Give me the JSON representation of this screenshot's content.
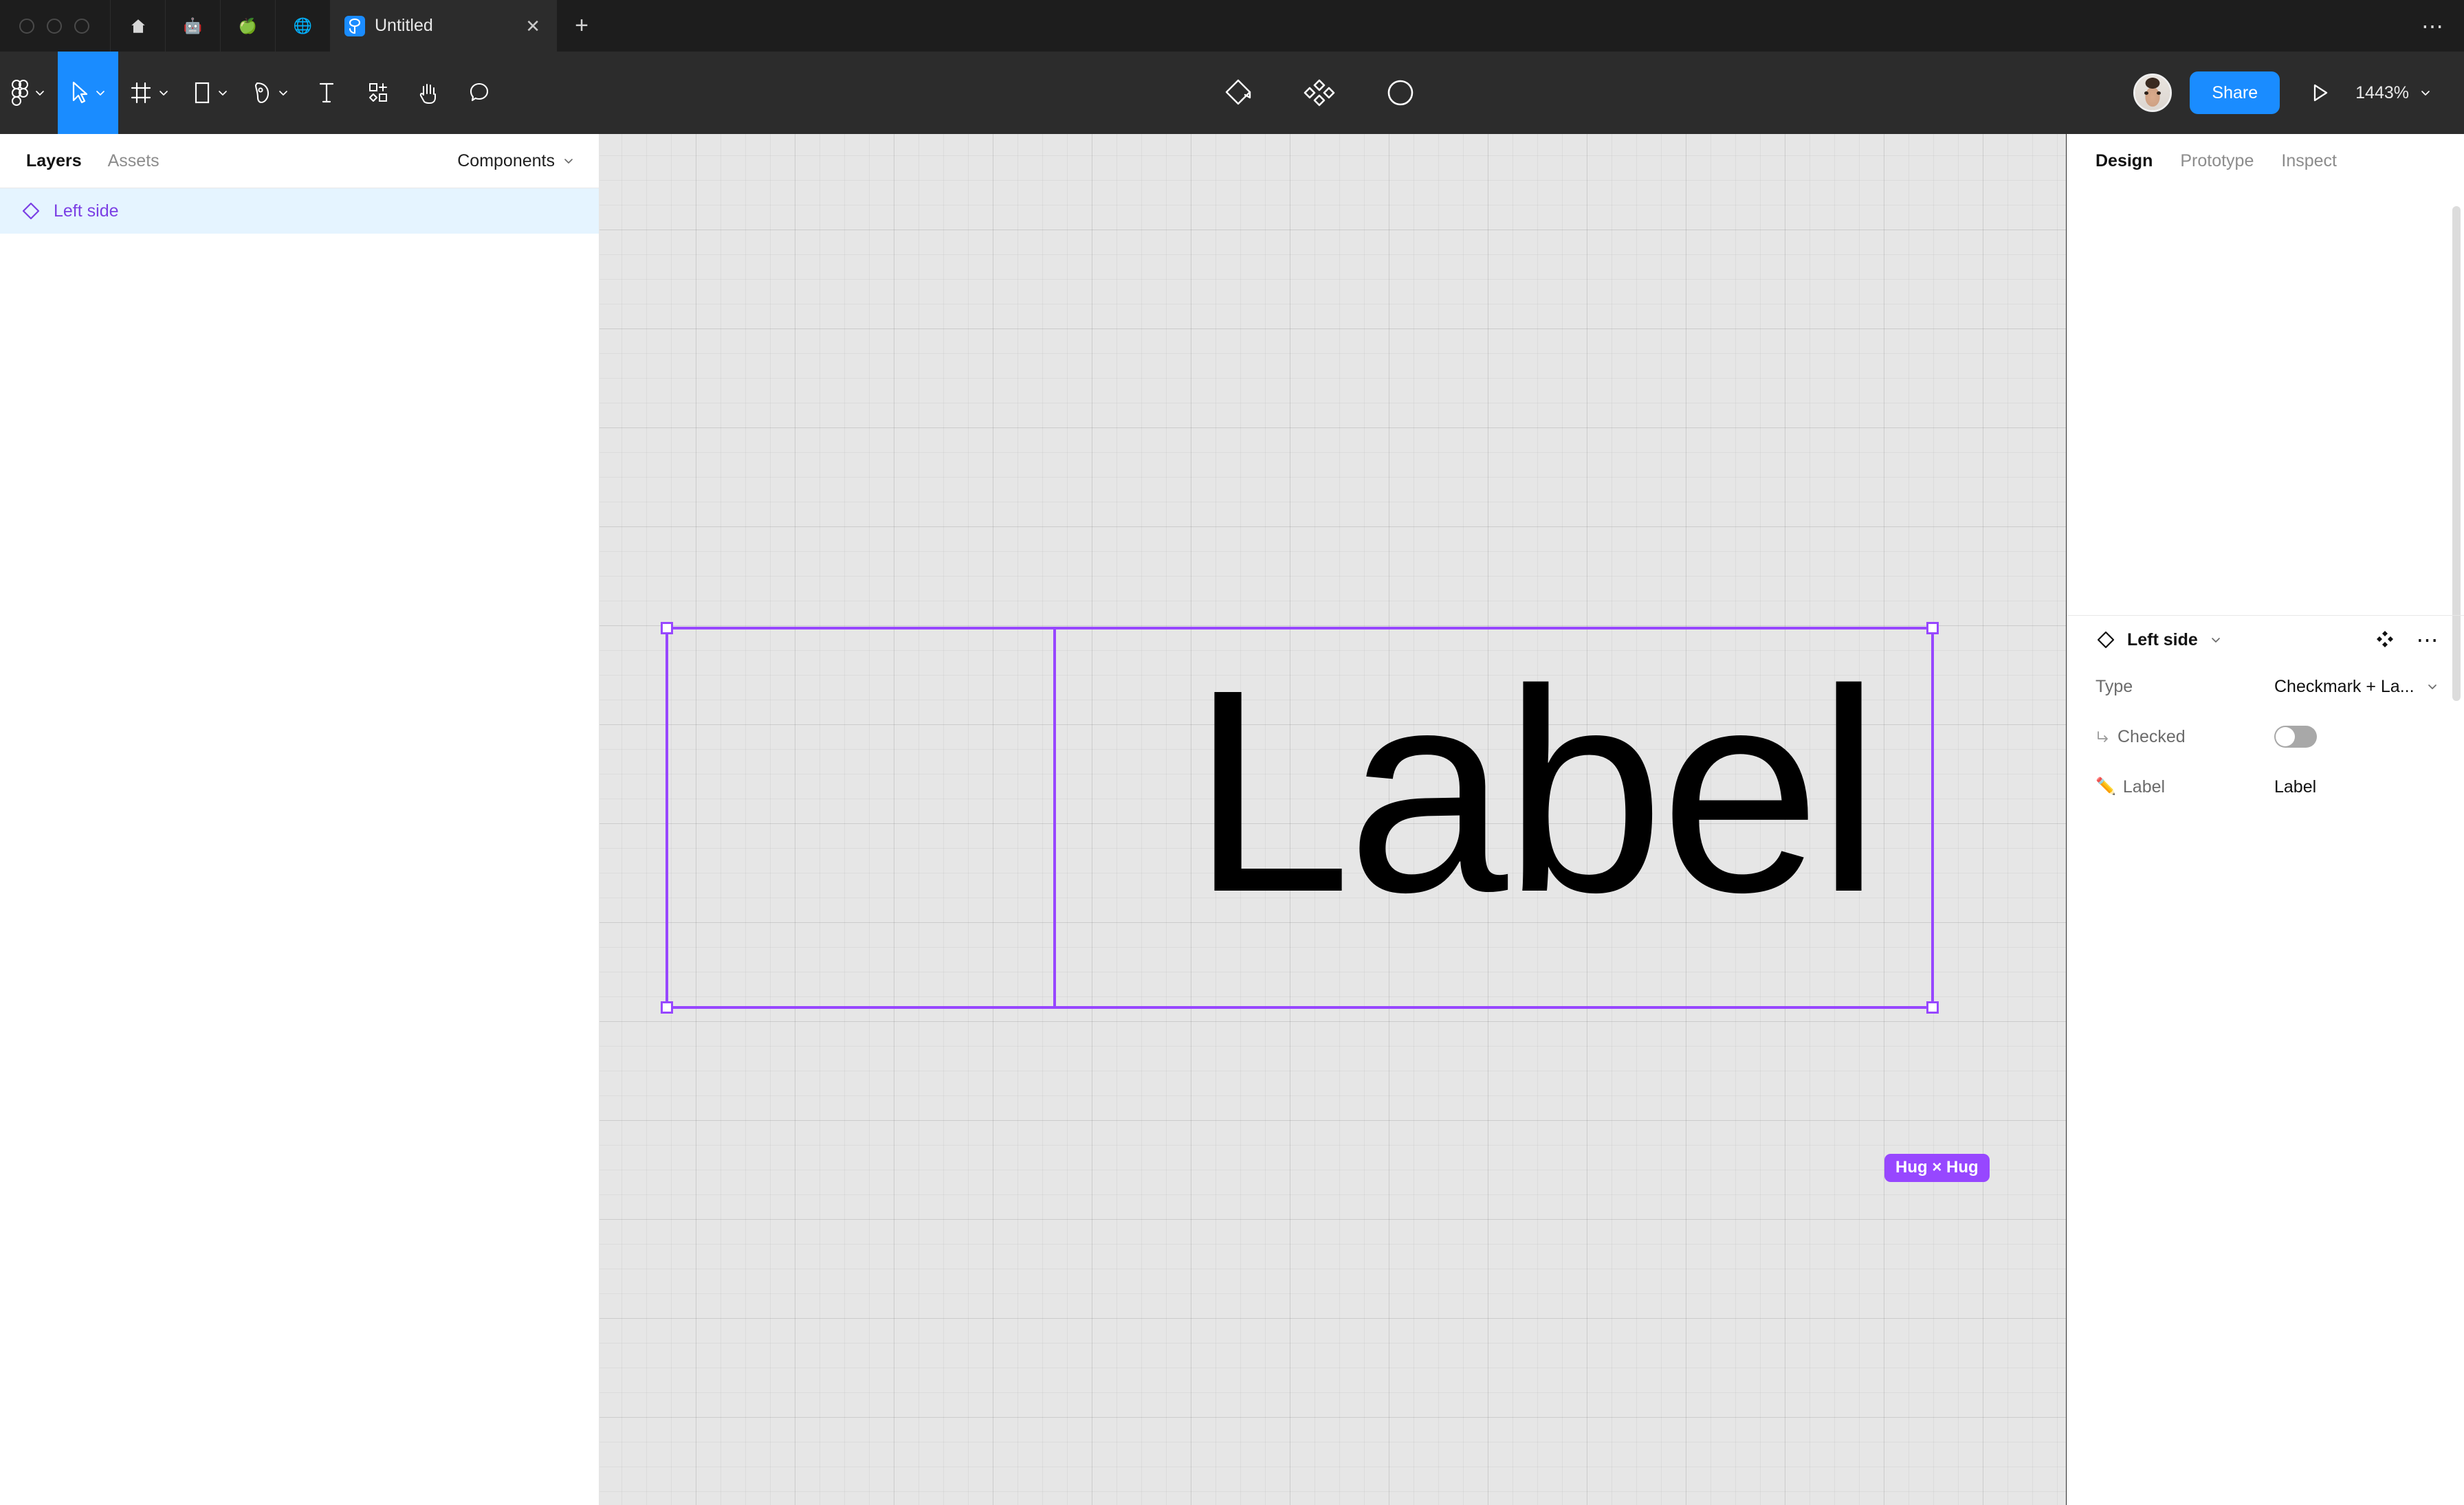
{
  "browser": {
    "window_controls": [
      "close",
      "minimize",
      "maximize"
    ],
    "pinned_tabs": [
      {
        "name": "home-tab",
        "icon": "home-icon"
      },
      {
        "name": "robot-tab",
        "icon": "robot-favicon"
      },
      {
        "name": "apple-tab",
        "icon": "apple-favicon"
      },
      {
        "name": "globe-tab",
        "icon": "globe-favicon"
      }
    ],
    "active_tab": {
      "title": "Untitled",
      "favicon": "figma-icon",
      "close_label": "✕"
    },
    "new_tab_label": "+",
    "overflow_menu_label": "⋯"
  },
  "toolbar": {
    "left_tools": [
      {
        "name": "figma-menu",
        "icon": "figma-logo-icon",
        "has_chevron": true,
        "active": false
      },
      {
        "name": "move-tool",
        "icon": "cursor-icon",
        "has_chevron": true,
        "active": true
      },
      {
        "name": "frame-tool",
        "icon": "frame-icon",
        "has_chevron": true,
        "active": false
      },
      {
        "name": "shape-tool",
        "icon": "rectangle-icon",
        "has_chevron": true,
        "active": false
      },
      {
        "name": "pen-tool",
        "icon": "pen-icon",
        "has_chevron": true,
        "active": false
      },
      {
        "name": "text-tool",
        "icon": "text-icon",
        "has_chevron": false,
        "active": false
      },
      {
        "name": "resources-tool",
        "icon": "components-plugins-icon",
        "has_chevron": false,
        "active": false
      },
      {
        "name": "hand-tool",
        "icon": "hand-icon",
        "has_chevron": false,
        "active": false
      },
      {
        "name": "comment-tool",
        "icon": "comment-bubble-icon",
        "has_chevron": false,
        "active": false
      }
    ],
    "center_actions": [
      {
        "name": "reset-component",
        "icon": "diamond-reset-icon"
      },
      {
        "name": "variants",
        "icon": "four-diamonds-icon"
      },
      {
        "name": "contrast-toggle",
        "icon": "half-circle-icon"
      }
    ],
    "avatar_name": "user-avatar",
    "share_label": "Share",
    "present_label": "▷",
    "zoom_level": "1443%"
  },
  "left_panel": {
    "tabs": [
      {
        "label": "Layers",
        "active": true
      },
      {
        "label": "Assets",
        "active": false
      }
    ],
    "components_label": "Components",
    "layers": [
      {
        "name": "Left side",
        "icon": "component-diamond-icon",
        "selected": true
      }
    ]
  },
  "canvas": {
    "selection": {
      "label_text": "Label",
      "size_badge": "Hug × Hug",
      "selection_color": "#9747ff"
    }
  },
  "right_panel": {
    "tabs": [
      {
        "label": "Design",
        "active": true
      },
      {
        "label": "Prototype",
        "active": false
      },
      {
        "label": "Inspect",
        "active": false
      }
    ],
    "component": {
      "name": "Left side",
      "icon": "component-diamond-icon",
      "swap_icon": "four-diamonds-icon",
      "more_label": "⋯"
    },
    "properties": [
      {
        "name": "Type",
        "value": "Checkmark + La...",
        "control": "dropdown",
        "prefix_icon": null
      },
      {
        "name": "Checked",
        "value": "",
        "control": "toggle",
        "toggle_on": false,
        "prefix_icon": "nested-instance-arrow-icon"
      },
      {
        "name": "Label",
        "value": "Label",
        "control": "text",
        "prefix_icon": "pencil-emoji"
      }
    ]
  }
}
